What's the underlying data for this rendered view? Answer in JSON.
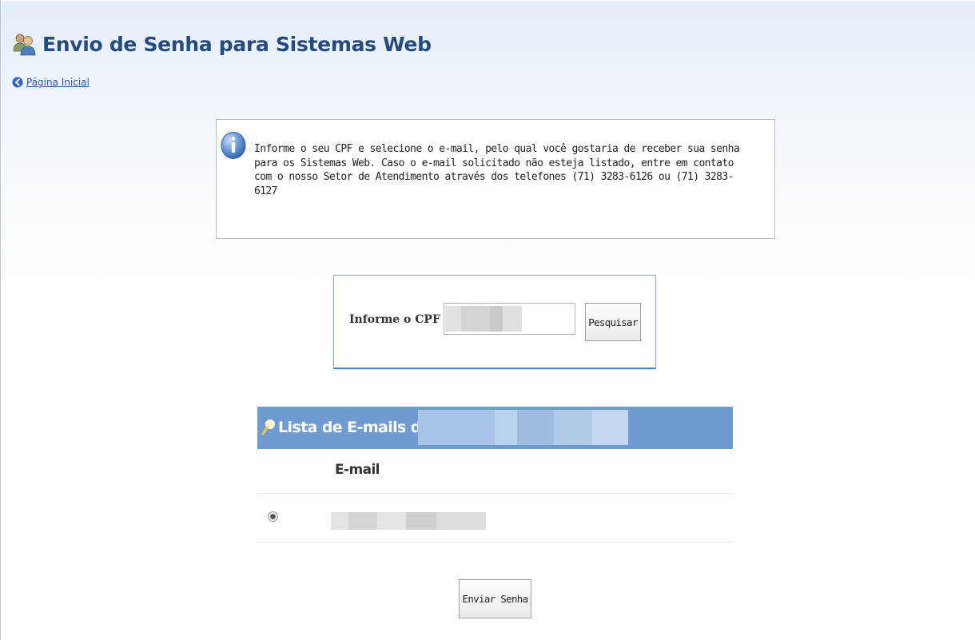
{
  "header": {
    "title": "Envio de Senha para Sistemas Web",
    "home_link": "Página Inicial"
  },
  "info": {
    "message": "Informe o seu CPF e selecione o e-mail, pelo qual você gostaria de receber sua senha para os Sistemas Web. Caso o e-mail solicitado não esteja listado, entre em contato com o nosso Setor de Atendimento através dos telefones (71) 3283-6126 ou (71) 3283-6127"
  },
  "cpf_form": {
    "label": "Informe o CPF",
    "search_label": "Pesquisar"
  },
  "email_list": {
    "title": "Lista de E-mails de",
    "column_header": "E-mail"
  },
  "actions": {
    "send_label": "Enviar Senha"
  },
  "colors": {
    "title": "#244a7f",
    "header_bar": "#6f9bd0",
    "link": "#2d4fb4"
  },
  "icons": {
    "header": "users-icon",
    "home": "back-arrow-icon",
    "info": "info-icon",
    "list": "magnifier-icon"
  }
}
